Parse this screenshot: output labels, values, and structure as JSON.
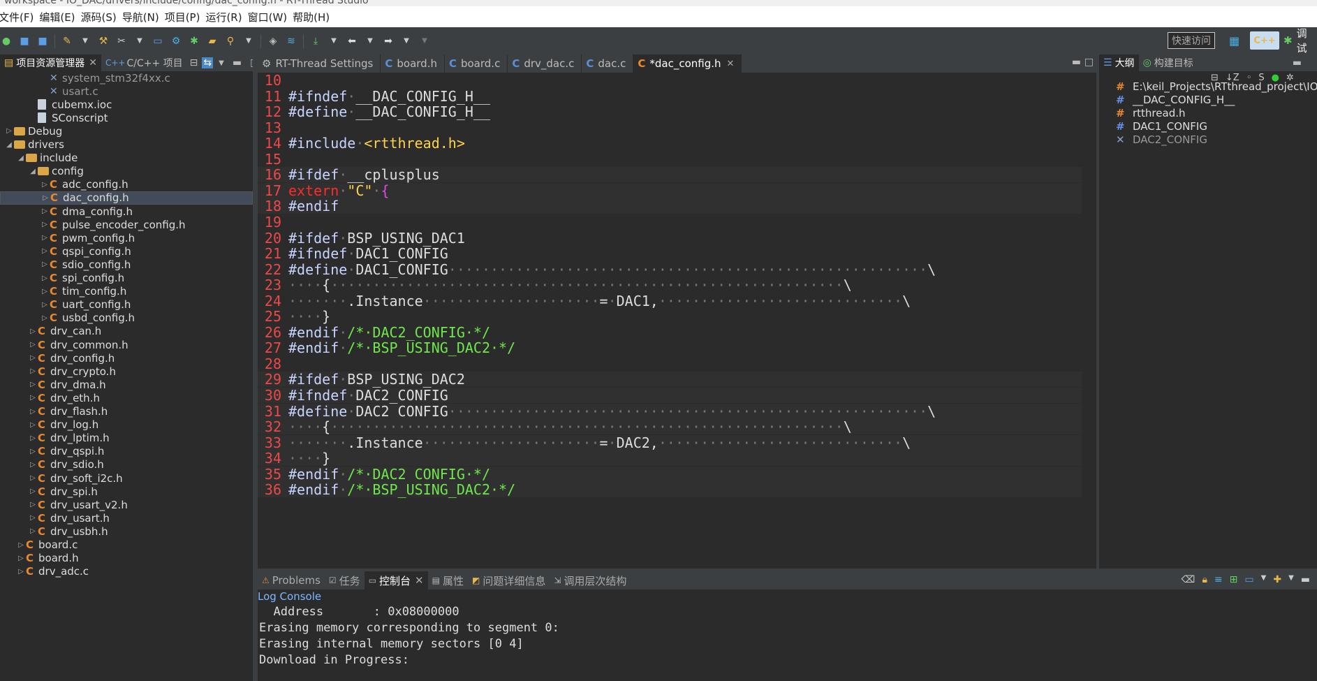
{
  "window": {
    "title": "workspace - IO_DAC/drivers/include/config/dac_config.h - RT-Thread Studio"
  },
  "menu": [
    "文件(F)",
    "编辑(E)",
    "源码(S)",
    "导航(N)",
    "项目(P)",
    "运行(R)",
    "窗口(W)",
    "帮助(H)"
  ],
  "toolbar": {
    "quick_access": "快速访问",
    "debug_label": "调试"
  },
  "left_panel": {
    "tabs": [
      "项目资源管理器",
      "C/C++ 项目"
    ],
    "tree": [
      {
        "label": "system_stm32f4xx.c",
        "indent": 3,
        "icon": "excluded-file-icon",
        "dim": true
      },
      {
        "label": "usart.c",
        "indent": 3,
        "icon": "excluded-file-icon",
        "dim": true
      },
      {
        "label": "cubemx.ioc",
        "indent": 2,
        "icon": "file-icon"
      },
      {
        "label": "SConscript",
        "indent": 2,
        "icon": "file-icon"
      },
      {
        "label": "Debug",
        "indent": 0,
        "icon": "folder-icon",
        "twisty": "▷"
      },
      {
        "label": "drivers",
        "indent": 0,
        "icon": "folder-icon",
        "twisty": "◢"
      },
      {
        "label": "include",
        "indent": 1,
        "icon": "folder-icon",
        "twisty": "◢"
      },
      {
        "label": "config",
        "indent": 2,
        "icon": "folder-icon",
        "twisty": "◢"
      },
      {
        "label": "adc_config.h",
        "indent": 3,
        "icon": "c-header-icon",
        "twisty": "▷"
      },
      {
        "label": "dac_config.h",
        "indent": 3,
        "icon": "c-header-icon",
        "twisty": "▷",
        "selected": true
      },
      {
        "label": "dma_config.h",
        "indent": 3,
        "icon": "c-header-icon",
        "twisty": "▷"
      },
      {
        "label": "pulse_encoder_config.h",
        "indent": 3,
        "icon": "c-header-icon",
        "twisty": "▷"
      },
      {
        "label": "pwm_config.h",
        "indent": 3,
        "icon": "c-header-icon",
        "twisty": "▷"
      },
      {
        "label": "qspi_config.h",
        "indent": 3,
        "icon": "c-header-icon",
        "twisty": "▷"
      },
      {
        "label": "sdio_config.h",
        "indent": 3,
        "icon": "c-header-icon",
        "twisty": "▷"
      },
      {
        "label": "spi_config.h",
        "indent": 3,
        "icon": "c-header-icon",
        "twisty": "▷"
      },
      {
        "label": "tim_config.h",
        "indent": 3,
        "icon": "c-header-icon",
        "twisty": "▷"
      },
      {
        "label": "uart_config.h",
        "indent": 3,
        "icon": "c-header-icon",
        "twisty": "▷"
      },
      {
        "label": "usbd_config.h",
        "indent": 3,
        "icon": "c-header-icon",
        "twisty": "▷"
      },
      {
        "label": "drv_can.h",
        "indent": 2,
        "icon": "c-header-icon",
        "twisty": "▷"
      },
      {
        "label": "drv_common.h",
        "indent": 2,
        "icon": "c-header-icon",
        "twisty": "▷"
      },
      {
        "label": "drv_config.h",
        "indent": 2,
        "icon": "c-header-icon",
        "twisty": "▷"
      },
      {
        "label": "drv_crypto.h",
        "indent": 2,
        "icon": "c-header-icon",
        "twisty": "▷"
      },
      {
        "label": "drv_dma.h",
        "indent": 2,
        "icon": "c-header-icon",
        "twisty": "▷"
      },
      {
        "label": "drv_eth.h",
        "indent": 2,
        "icon": "c-header-icon",
        "twisty": "▷"
      },
      {
        "label": "drv_flash.h",
        "indent": 2,
        "icon": "c-header-icon",
        "twisty": "▷"
      },
      {
        "label": "drv_log.h",
        "indent": 2,
        "icon": "c-header-icon",
        "twisty": "▷"
      },
      {
        "label": "drv_lptim.h",
        "indent": 2,
        "icon": "c-header-icon",
        "twisty": "▷"
      },
      {
        "label": "drv_qspi.h",
        "indent": 2,
        "icon": "c-header-icon",
        "twisty": "▷"
      },
      {
        "label": "drv_sdio.h",
        "indent": 2,
        "icon": "c-header-icon",
        "twisty": "▷"
      },
      {
        "label": "drv_soft_i2c.h",
        "indent": 2,
        "icon": "c-header-icon",
        "twisty": "▷"
      },
      {
        "label": "drv_spi.h",
        "indent": 2,
        "icon": "c-header-icon",
        "twisty": "▷"
      },
      {
        "label": "drv_usart_v2.h",
        "indent": 2,
        "icon": "c-header-icon",
        "twisty": "▷"
      },
      {
        "label": "drv_usart.h",
        "indent": 2,
        "icon": "c-header-icon",
        "twisty": "▷"
      },
      {
        "label": "drv_usbh.h",
        "indent": 2,
        "icon": "c-header-icon",
        "twisty": "▷"
      },
      {
        "label": "board.c",
        "indent": 1,
        "icon": "c-source-icon",
        "twisty": "▷"
      },
      {
        "label": "board.h",
        "indent": 1,
        "icon": "c-header-icon",
        "twisty": "▷"
      },
      {
        "label": "drv_adc.c",
        "indent": 1,
        "icon": "c-source-icon",
        "twisty": "▷"
      }
    ]
  },
  "editor": {
    "tabs": [
      {
        "label": "RT-Thread Settings",
        "icon": "settings-icon"
      },
      {
        "label": "board.h",
        "icon": "c-header-icon"
      },
      {
        "label": "board.c",
        "icon": "c-source-icon"
      },
      {
        "label": "drv_dac.c",
        "icon": "c-source-icon"
      },
      {
        "label": "dac.c",
        "icon": "c-source-icon"
      },
      {
        "label": "*dac_config.h",
        "icon": "c-header-icon",
        "active": true
      }
    ],
    "lines": [
      {
        "n": "10",
        "text": ""
      },
      {
        "n": "11",
        "text": "#ifndef·__DAC_CONFIG_H__"
      },
      {
        "n": "12",
        "text": "#define·__DAC_CONFIG_H__"
      },
      {
        "n": "13",
        "text": ""
      },
      {
        "n": "14",
        "text": "#include·<rtthread.h>"
      },
      {
        "n": "15",
        "text": ""
      },
      {
        "n": "16",
        "text": "#ifdef·__cplusplus"
      },
      {
        "n": "17",
        "text": "extern·\"C\"·{"
      },
      {
        "n": "18",
        "text": "#endif"
      },
      {
        "n": "19",
        "text": ""
      },
      {
        "n": "20",
        "text": "#ifdef·BSP_USING_DAC1"
      },
      {
        "n": "21",
        "text": "#ifndef·DAC1_CONFIG"
      },
      {
        "n": "22",
        "text": "#define·DAC1_CONFIG·························································\\"
      },
      {
        "n": "23",
        "text": "····{·····························································\\"
      },
      {
        "n": "24",
        "text": "·······.Instance·····················=·DAC1,·····························\\"
      },
      {
        "n": "25",
        "text": "····}"
      },
      {
        "n": "26",
        "text": "#endif·/*·DAC2_CONFIG·*/"
      },
      {
        "n": "27",
        "text": "#endif·/*·BSP_USING_DAC2·*/"
      },
      {
        "n": "28",
        "text": ""
      },
      {
        "n": "29",
        "text": "#ifdef·BSP_USING_DAC2"
      },
      {
        "n": "30",
        "text": "#ifndef·DAC2_CONFIG"
      },
      {
        "n": "31",
        "text": "#define·DAC2_CONFIG·························································\\"
      },
      {
        "n": "32",
        "text": "····{·····························································\\"
      },
      {
        "n": "33",
        "text": "·······.Instance·····················=·DAC2,·····························\\"
      },
      {
        "n": "34",
        "text": "····}"
      },
      {
        "n": "35",
        "text": "#endif·/*·DAC2_CONFIG·*/"
      },
      {
        "n": "36",
        "text": "#endif·/*·BSP_USING_DAC2·*/"
      }
    ]
  },
  "outline": {
    "tabs": [
      "大纲",
      "构建目标"
    ],
    "items": [
      {
        "label": "E:\\keil_Projects\\RTthread_project\\IO",
        "icon": "include-icon",
        "color": "#e8892e"
      },
      {
        "label": "__DAC_CONFIG_H__",
        "icon": "macro-icon",
        "color": "#6a8fe8"
      },
      {
        "label": "rtthread.h",
        "icon": "include-icon",
        "color": "#e8892e"
      },
      {
        "label": "DAC1_CONFIG",
        "icon": "macro-icon",
        "color": "#6a8fe8"
      },
      {
        "label": "DAC2_CONFIG",
        "icon": "inactive-macro-icon",
        "color": "#8aa0c8",
        "dim": true
      }
    ]
  },
  "console": {
    "tabs": [
      "Problems",
      "任务",
      "控制台",
      "属性",
      "问题详细信息",
      "调用层次结构"
    ],
    "active_tab": "控制台",
    "title": "Log Console",
    "lines": [
      "  Address       : 0x08000000",
      "Erasing memory corresponding to segment 0:",
      "Erasing internal memory sectors [0 4]",
      "Download in Progress:"
    ]
  }
}
